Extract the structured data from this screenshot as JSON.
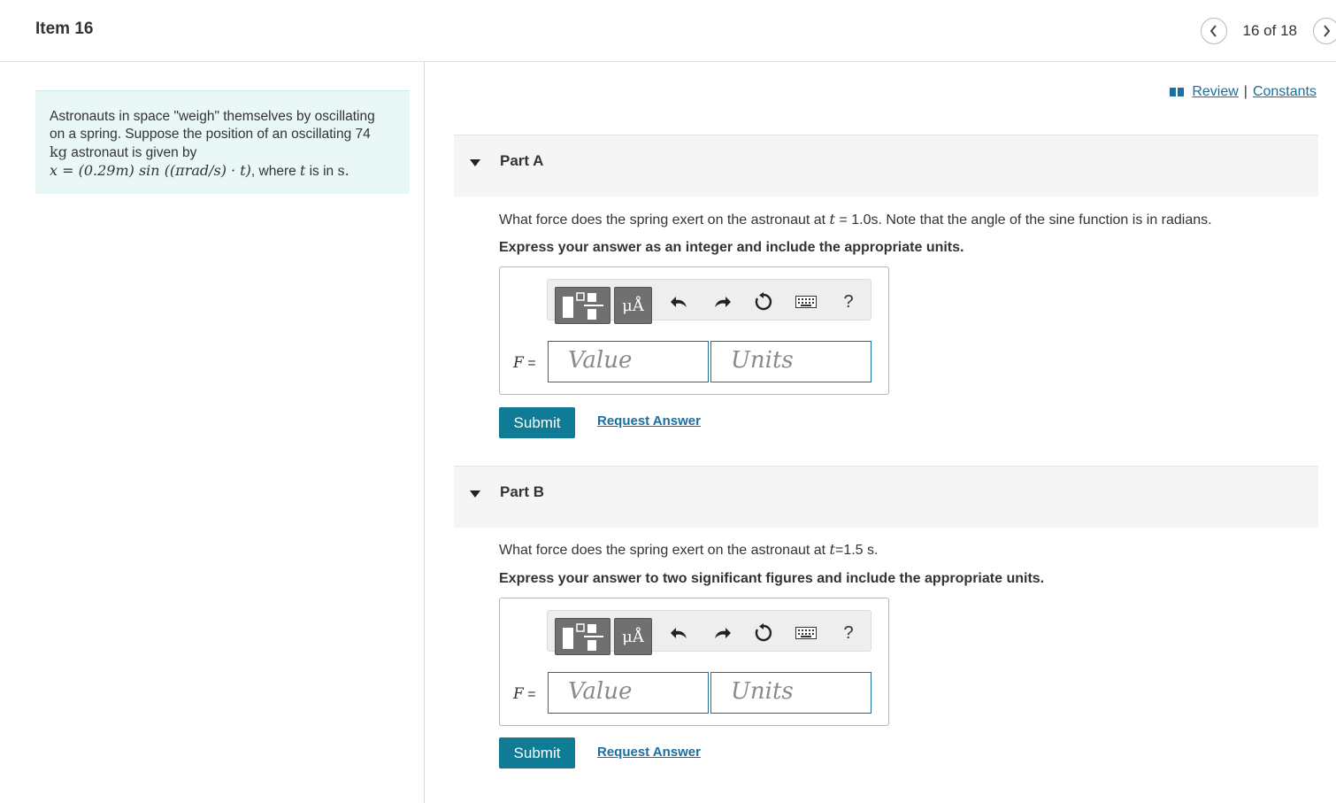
{
  "header": {
    "item_title": "Item 16",
    "position": "16 of 18",
    "prev_icon": "chevron-left-icon",
    "next_icon": "chevron-right-icon"
  },
  "intro": {
    "line1": "Astronauts in space \"weigh\" themselves by oscillating",
    "line2": "on a spring. Suppose the position of an oscillating 74",
    "line3_unit": "kg",
    "line3_text": " astronaut is given by",
    "equation": "x = (0.29m) sin ((πrad/s) · t)",
    "tail_where": ", where ",
    "tail_t": "t",
    "tail_is_in": " is in ",
    "tail_unit": "s."
  },
  "links": {
    "review": "Review",
    "separator": "|",
    "constants": "Constants",
    "icon": "book-icon"
  },
  "parts": [
    {
      "title": "Part A",
      "question_pre": "What force does the spring exert on the astronaut at ",
      "question_var": "t",
      "question_post": " = 1.0s. Note that the angle of the sine function is in radians.",
      "instruction": "Express your answer as an integer and include the appropriate units.",
      "units_btn": "μÅ",
      "help": "?",
      "var_label": "F",
      "eq": " =",
      "value_placeholder": "Value",
      "units_placeholder": "Units",
      "submit": "Submit",
      "request": "Request Answer"
    },
    {
      "title": "Part B",
      "question_pre": "What force does the spring exert on the astronaut at ",
      "question_var": "t",
      "question_post": "=1.5 s.",
      "instruction": "Express your answer to two significant figures and include the appropriate units.",
      "units_btn": "μÅ",
      "help": "?",
      "var_label": "F",
      "eq": " =",
      "value_placeholder": "Value",
      "units_placeholder": "Units",
      "submit": "Submit",
      "request": "Request Answer"
    }
  ],
  "colors": {
    "accent": "#0f7b95",
    "link": "#1a6fa0",
    "intro_bg": "#e9f7f7"
  }
}
